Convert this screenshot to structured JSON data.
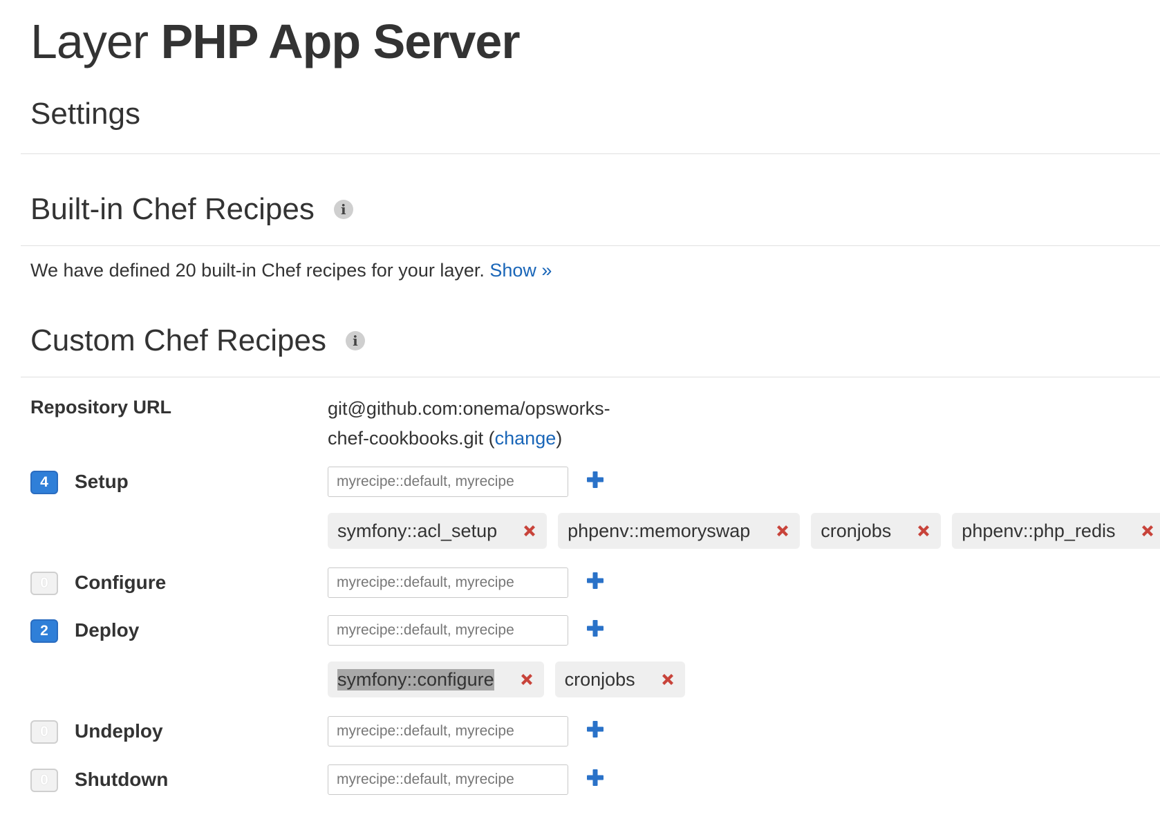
{
  "header": {
    "title_prefix": "Layer",
    "title_name": "PHP App Server"
  },
  "settings": {
    "title": "Settings"
  },
  "builtin": {
    "title": "Built-in Chef Recipes",
    "info_glyph": "i",
    "text": "We have defined 20 built-in Chef recipes for your layer.",
    "show_link": "Show »"
  },
  "custom": {
    "title": "Custom Chef Recipes",
    "info_glyph": "i",
    "repo_label": "Repository URL",
    "repo_line1": "git@github.com:onema/opsworks-",
    "repo_line2": "chef-cookbooks.git",
    "repo_paren_open": "(",
    "repo_change": "change",
    "repo_paren_close": ")"
  },
  "input_placeholder": "myrecipe::default, myrecipe",
  "events": {
    "setup": {
      "count": "4",
      "label": "Setup",
      "tags": [
        "symfony::acl_setup",
        "phpenv::memoryswap",
        "cronjobs",
        "phpenv::php_redis"
      ]
    },
    "configure": {
      "count": "0",
      "label": "Configure"
    },
    "deploy": {
      "count": "2",
      "label": "Deploy",
      "tags": [
        "symfony::configure",
        "cronjobs"
      ]
    },
    "undeploy": {
      "count": "0",
      "label": "Undeploy"
    },
    "shutdown": {
      "count": "0",
      "label": "Shutdown"
    }
  },
  "icons": {
    "info": "info-icon",
    "add": "plus-icon",
    "remove": "x-icon"
  },
  "colors": {
    "link": "#1a66b8",
    "badge_active": "#2f7fd8",
    "plus": "#2a72c8",
    "remove": "#c8433a"
  }
}
